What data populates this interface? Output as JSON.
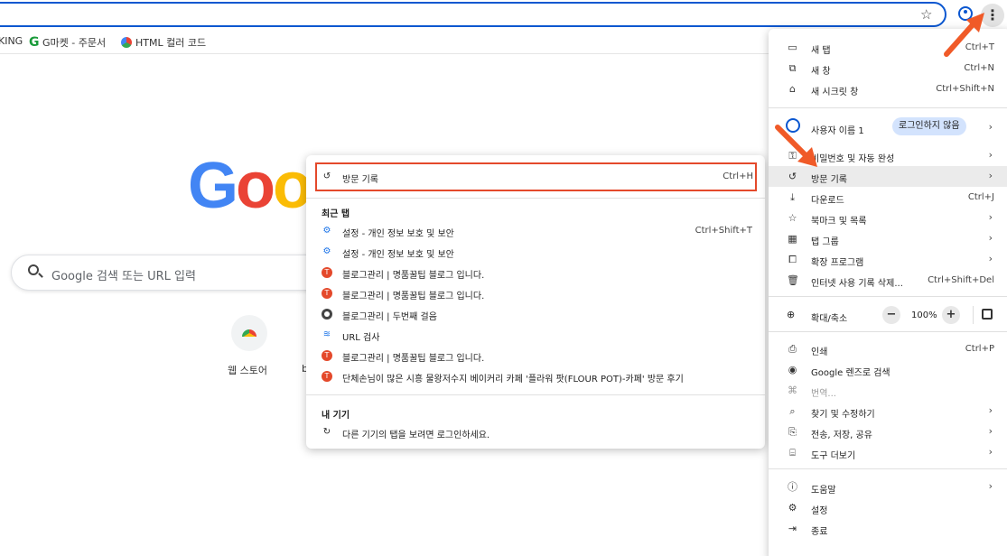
{
  "bookmarks": {
    "items": [
      {
        "label": "KING"
      },
      {
        "label": "G마켓 - 주문서"
      },
      {
        "label": "HTML 컬러 코드"
      }
    ]
  },
  "page": {
    "logo_letters": [
      "G",
      "o",
      "o"
    ],
    "search_placeholder": "Google 검색 또는 URL 입력",
    "shortcut_label": "웹 스토어",
    "shortcut_label2": "b"
  },
  "history_submenu": {
    "history": {
      "label": "방문 기록",
      "shortcut": "Ctrl+H"
    },
    "recent_tabs_heading": "최근 탭",
    "recent_tabs": [
      {
        "label": "설정 - 개인 정보 보호 및 보안",
        "shortcut": "Ctrl+Shift+T",
        "icon": "gear-icon"
      },
      {
        "label": "설정 - 개인 정보 보호 및 보안",
        "shortcut": "",
        "icon": "gear-icon"
      },
      {
        "label": "블로그관리 | 명품꿀팁 블로그 입니다.",
        "shortcut": "",
        "icon": "blog-favicon"
      },
      {
        "label": "블로그관리 | 명품꿀팁 블로그 입니다.",
        "shortcut": "",
        "icon": "blog-favicon"
      },
      {
        "label": "블로그관리 | 두번째 걸음",
        "shortcut": "",
        "icon": "globe-icon"
      },
      {
        "label": "URL 검사",
        "shortcut": "",
        "icon": "url-inspect-icon"
      },
      {
        "label": "블로그관리 | 명품꿀팁 블로그 입니다.",
        "shortcut": "",
        "icon": "blog-favicon"
      },
      {
        "label": "단체손님이 많은 시흥 물왕저수지 베이커리 카페 '플라워 팟(FLOUR POT)-카페' 방문 후기",
        "shortcut": "",
        "icon": "blog-favicon"
      }
    ],
    "my_devices_heading": "내 기기",
    "my_devices_text": "다른 기기의 탭을 보려면 로그인하세요."
  },
  "menu": {
    "top_items": [
      {
        "label": "새 탭",
        "shortcut": "Ctrl+T"
      },
      {
        "label": "새 창",
        "shortcut": "Ctrl+N"
      },
      {
        "label": "새 시크릿 창",
        "shortcut": "Ctrl+Shift+N"
      }
    ],
    "profile": {
      "name": "사용자 이름 1",
      "badge": "로그인하지 않음"
    },
    "mid_items": [
      {
        "label": "비밀번호 및 자동 완성",
        "shortcut": ""
      },
      {
        "label": "방문 기록",
        "shortcut": ""
      },
      {
        "label": "다운로드",
        "shortcut": "Ctrl+J"
      },
      {
        "label": "북마크 및 목록",
        "shortcut": ""
      },
      {
        "label": "탭 그룹",
        "shortcut": ""
      },
      {
        "label": "확장 프로그램",
        "shortcut": ""
      },
      {
        "label": "인터넷 사용 기록 삭제...",
        "shortcut": "Ctrl+Shift+Del"
      }
    ],
    "zoom": {
      "label": "확대/축소",
      "value": "100%",
      "minus": "−",
      "plus": "+"
    },
    "tool_items": [
      {
        "label": "인쇄",
        "shortcut": "Ctrl+P"
      },
      {
        "label": "Google 렌즈로 검색",
        "shortcut": ""
      },
      {
        "label": "번역...",
        "shortcut": ""
      },
      {
        "label": "찾기 및 수정하기",
        "shortcut": ""
      },
      {
        "label": "전송, 저장, 공유",
        "shortcut": ""
      },
      {
        "label": "도구 더보기",
        "shortcut": ""
      }
    ],
    "bottom_items": [
      {
        "label": "도움말"
      },
      {
        "label": "설정"
      },
      {
        "label": "종료"
      }
    ]
  },
  "colors": {
    "highlight_border": "#e4492b",
    "arrow": "#f05a28",
    "accent": "#0b57d0"
  }
}
